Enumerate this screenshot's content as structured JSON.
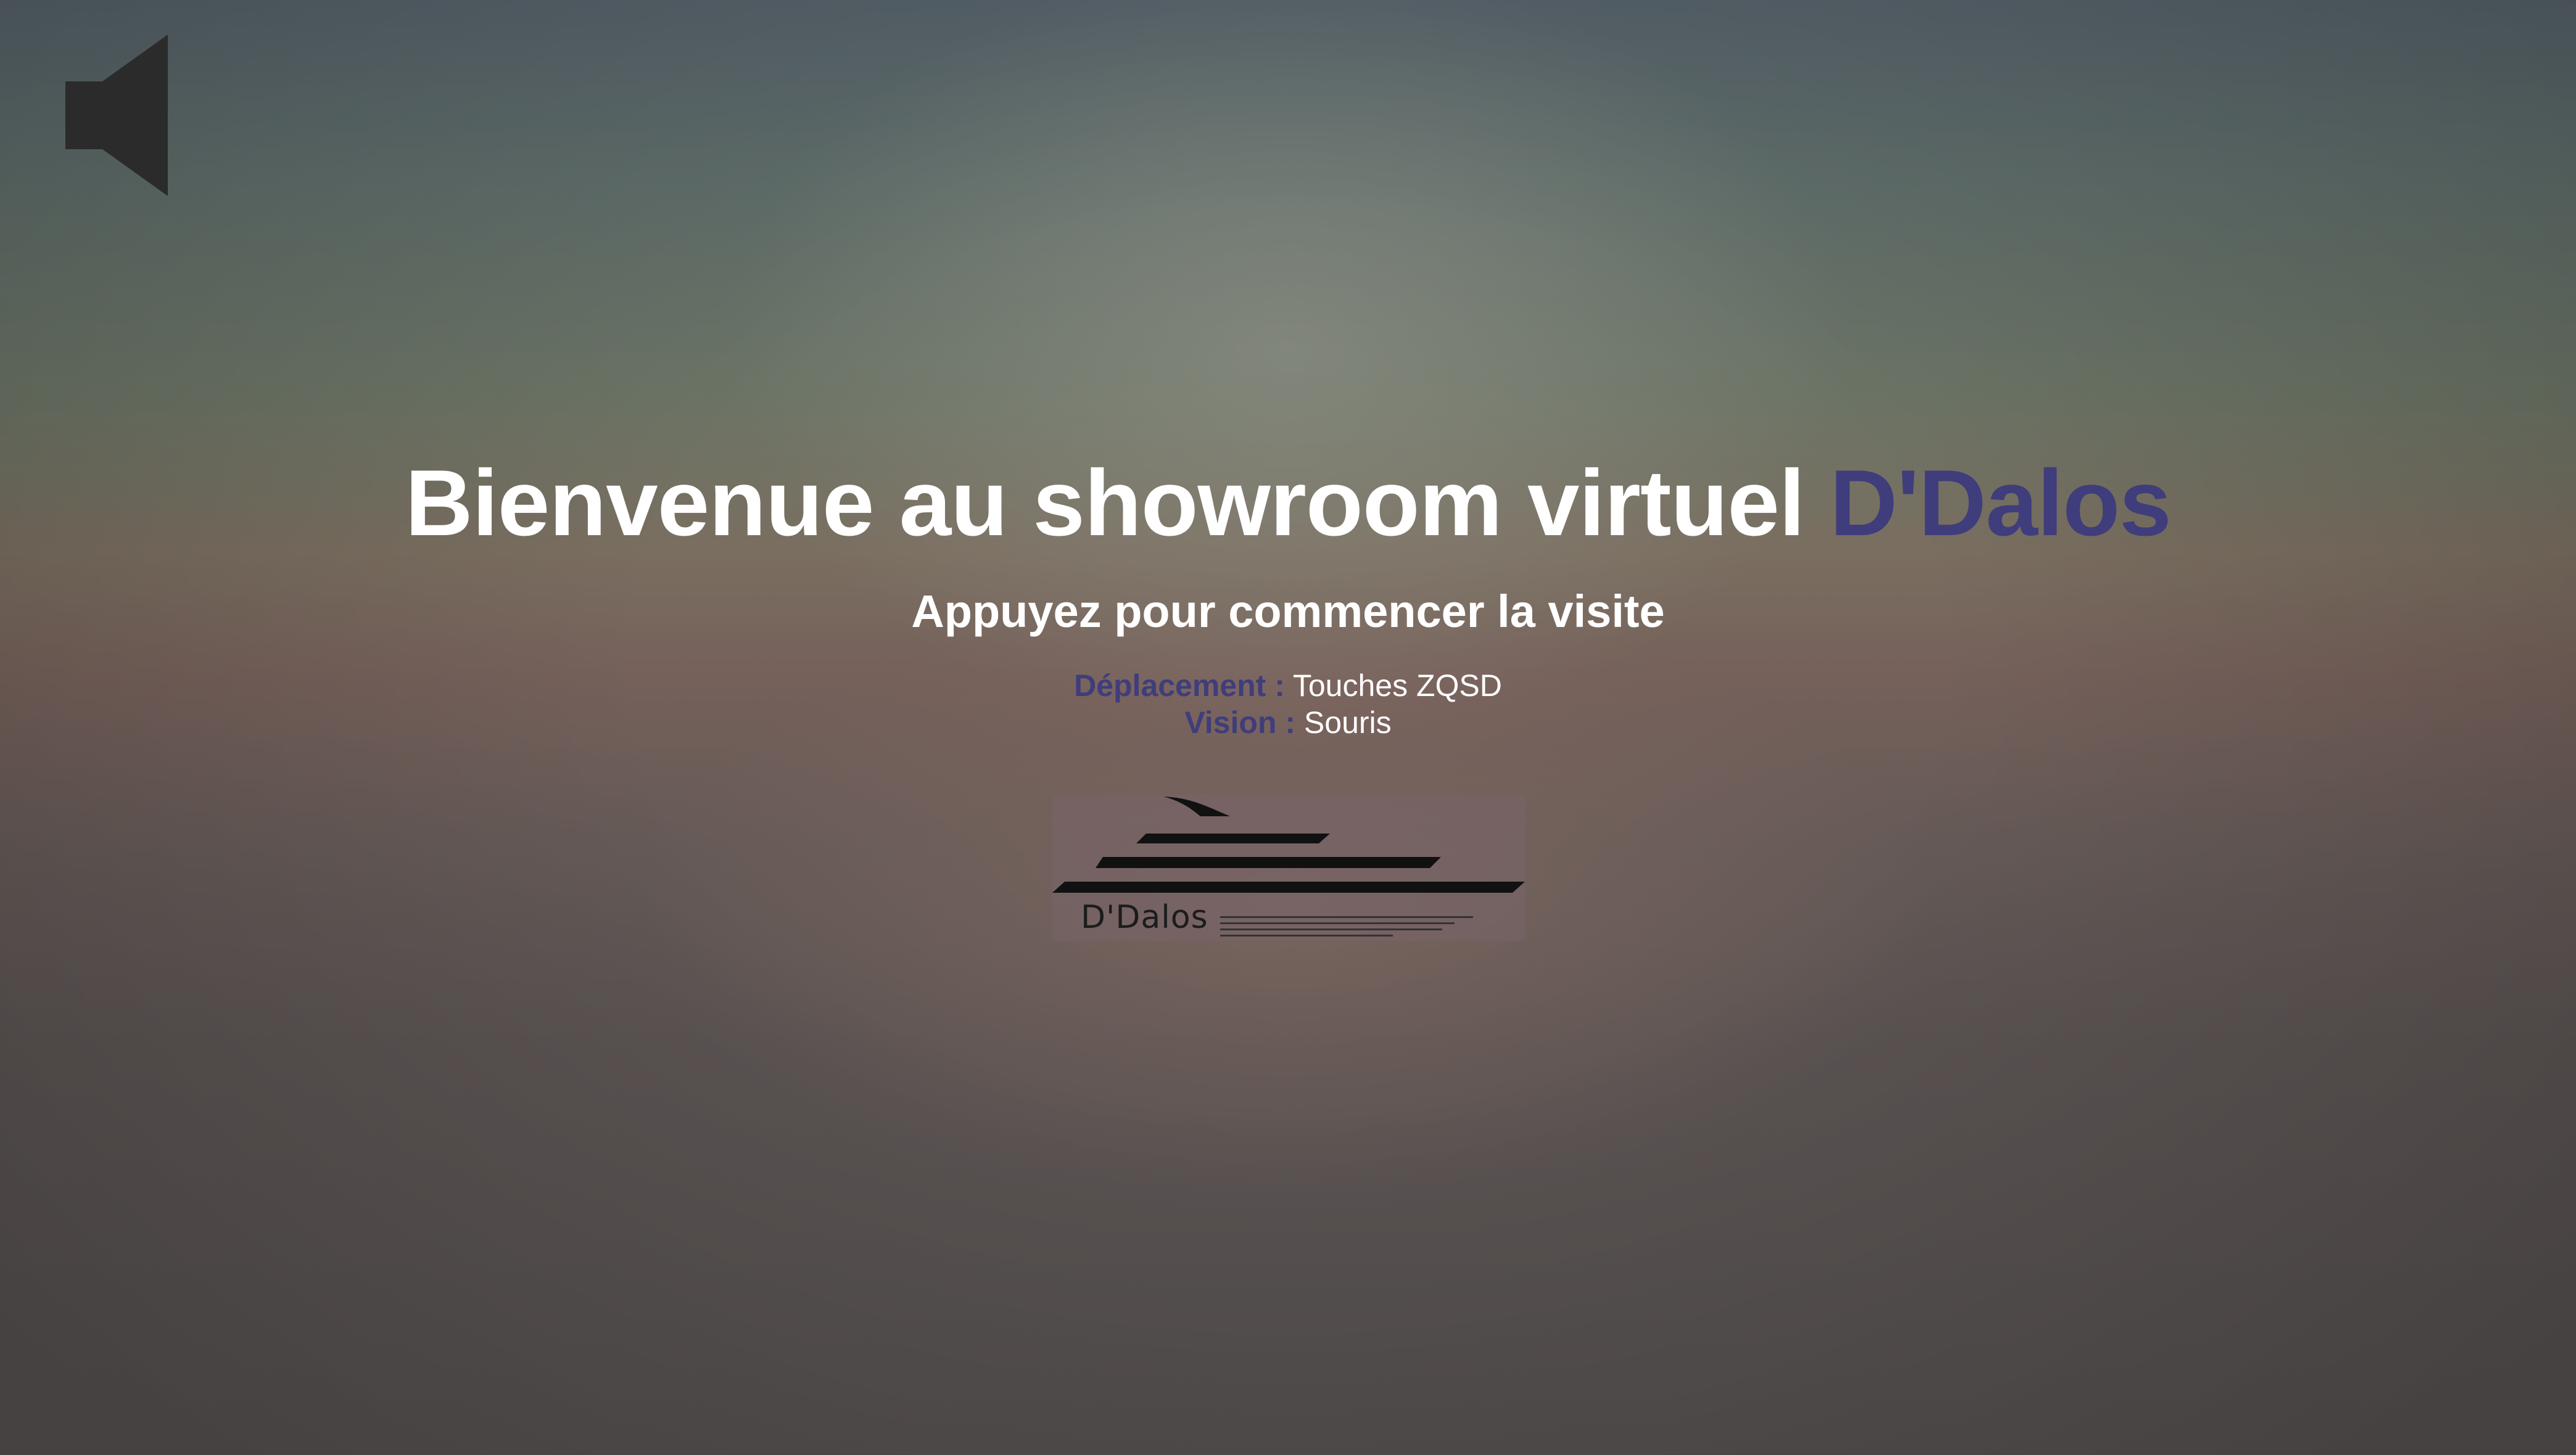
{
  "sound_toggle": {
    "icon": "speaker-muted-icon",
    "color": "#2b2b2b"
  },
  "welcome": {
    "title_prefix": "Bienvenue au showroom virtuel",
    "title_brand": "D'Dalos",
    "subtitle": "Appuyez pour commencer la visite"
  },
  "controls": [
    {
      "key": "Déplacement :",
      "value": "Touches ZQSD"
    },
    {
      "key": "Vision :",
      "value": "Souris"
    }
  ],
  "logo": {
    "text": "D'Dalos",
    "icon": "yacht-logo-icon"
  },
  "colors": {
    "brand": "#3f3d7b",
    "text": "#ffffff"
  }
}
